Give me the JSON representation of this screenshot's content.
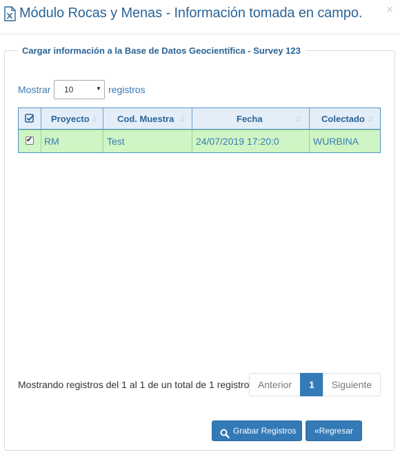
{
  "header": {
    "title": "Módulo Rocas y Menas - Información tomada en campo.",
    "close_symbol": "×",
    "icon": "excel-file-icon"
  },
  "panel": {
    "legend": "Cargar información a la Base de Datos Geocientífica - Survey 123"
  },
  "length_control": {
    "prefix": "Mostrar",
    "selected": "10",
    "suffix": "registros"
  },
  "table": {
    "columns": [
      "Proyecto",
      "Cod. Muestra",
      "Fecha",
      "Colectado"
    ],
    "rows": [
      {
        "checked": true,
        "proyecto": "RM",
        "cod_muestra": "Test",
        "fecha": "24/07/2019 17:20:0",
        "colectado": "WURBINA"
      }
    ]
  },
  "info": "Mostrando registros del 1 al 1 de un total de 1 registro",
  "pagination": {
    "previous": "Anterior",
    "pages": [
      "1"
    ],
    "next": "Siguiente"
  },
  "buttons": {
    "save": "Grabar Registros",
    "back": "«Regresar"
  },
  "colors": {
    "accent": "#337ab7",
    "title": "#2a6496",
    "row_selected": "#cff5c4"
  }
}
